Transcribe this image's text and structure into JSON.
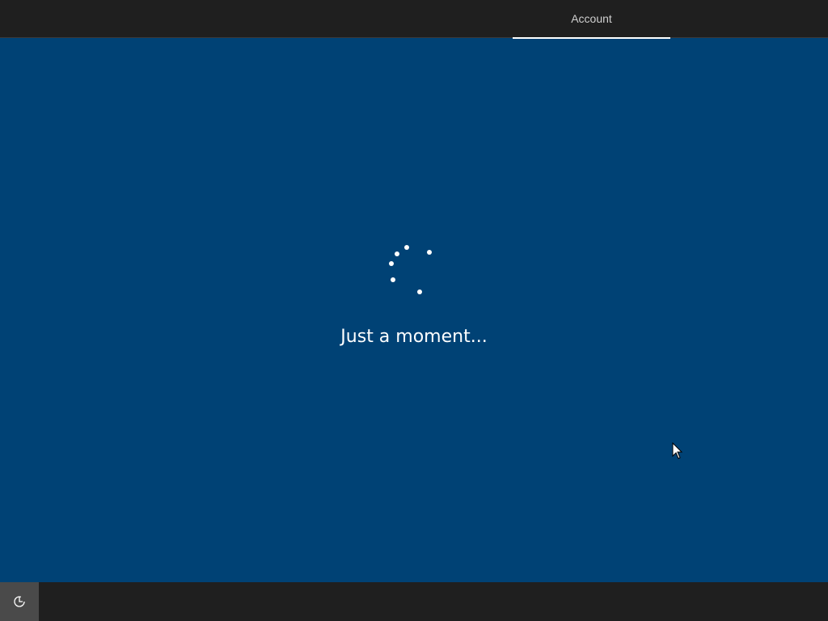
{
  "header": {
    "tabs": [
      {
        "label": "Account",
        "selected": true
      }
    ]
  },
  "main": {
    "message": "Just a moment..."
  },
  "footer": {
    "accessibility_icon": "ease-of-access-icon"
  },
  "colors": {
    "background": "#004275",
    "bar": "#1f1f1f",
    "accent": "#ffffff"
  }
}
